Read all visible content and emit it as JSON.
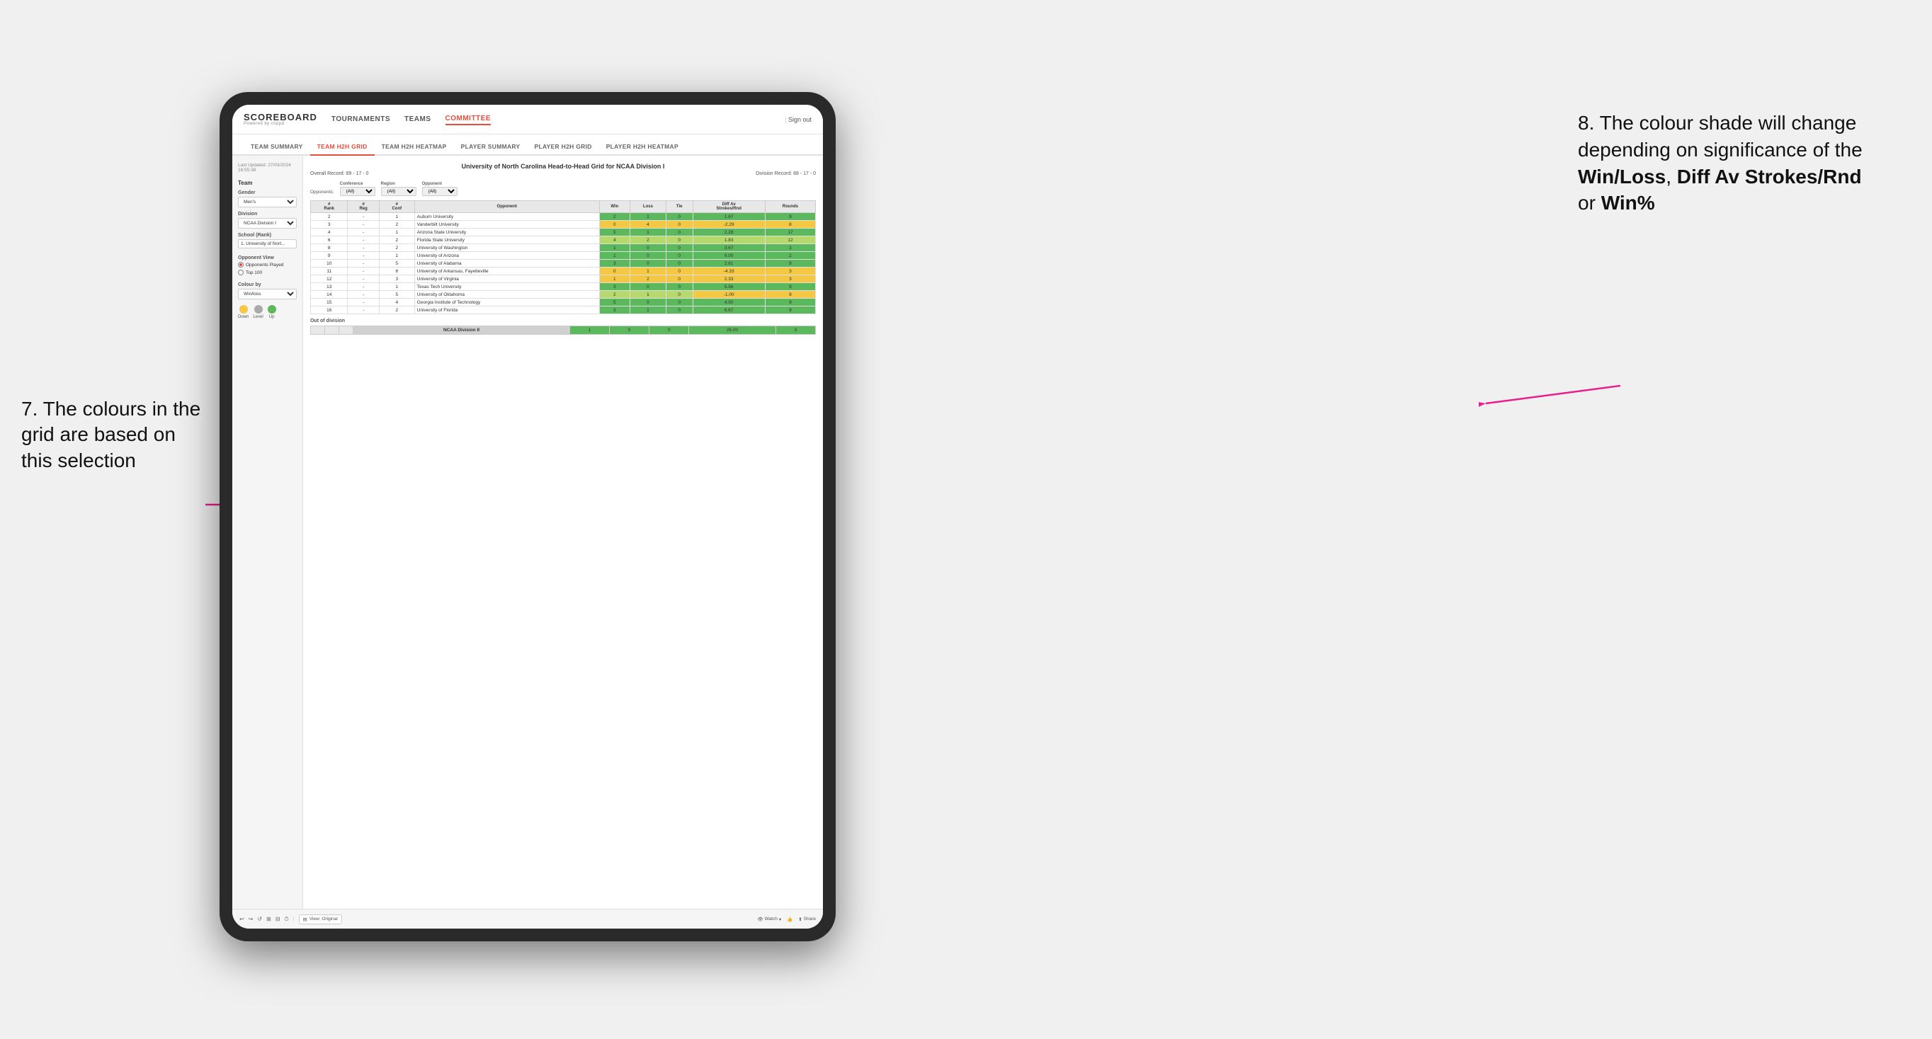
{
  "app": {
    "logo": "SCOREBOARD",
    "logo_sub": "Powered by clippd",
    "sign_out": "Sign out"
  },
  "nav": {
    "items": [
      {
        "label": "TOURNAMENTS",
        "active": false
      },
      {
        "label": "TEAMS",
        "active": false
      },
      {
        "label": "COMMITTEE",
        "active": true
      }
    ]
  },
  "sub_nav": {
    "items": [
      {
        "label": "TEAM SUMMARY",
        "active": false
      },
      {
        "label": "TEAM H2H GRID",
        "active": true
      },
      {
        "label": "TEAM H2H HEATMAP",
        "active": false
      },
      {
        "label": "PLAYER SUMMARY",
        "active": false
      },
      {
        "label": "PLAYER H2H GRID",
        "active": false
      },
      {
        "label": "PLAYER H2H HEATMAP",
        "active": false
      }
    ]
  },
  "sidebar": {
    "timestamp_label": "Last Updated: 27/03/2024",
    "timestamp_time": "16:55:38",
    "team_label": "Team",
    "gender_label": "Gender",
    "gender_value": "Men's",
    "division_label": "Division",
    "division_value": "NCAA Division I",
    "school_label": "School (Rank)",
    "school_value": "1. University of Nort...",
    "opponent_view_label": "Opponent View",
    "radio_options": [
      {
        "label": "Opponents Played",
        "selected": true
      },
      {
        "label": "Top 100",
        "selected": false
      }
    ],
    "colour_by_label": "Colour by",
    "colour_by_value": "Win/loss",
    "legend": [
      {
        "color": "#f4c842",
        "label": "Down"
      },
      {
        "color": "#aaaaaa",
        "label": "Level"
      },
      {
        "color": "#5cb85c",
        "label": "Up"
      }
    ]
  },
  "grid": {
    "title": "University of North Carolina Head-to-Head Grid for NCAA Division I",
    "overall_record": "Overall Record: 89 - 17 - 0",
    "division_record": "Division Record: 88 - 17 - 0",
    "filters": {
      "opponents_label": "Opponents:",
      "conference_label": "Conference",
      "conference_value": "(All)",
      "region_label": "Region",
      "region_value": "(All)",
      "opponent_label": "Opponent",
      "opponent_value": "(All)"
    },
    "columns": [
      "#\nRank",
      "# Reg",
      "# Conf",
      "Opponent",
      "Win",
      "Loss",
      "Tie",
      "Diff Av\nStrokes/Rnd",
      "Rounds"
    ],
    "rows": [
      {
        "rank": "2",
        "reg": "-",
        "conf": "1",
        "opponent": "Auburn University",
        "win": "2",
        "loss": "1",
        "tie": "0",
        "diff": "1.67",
        "rounds": "9",
        "win_color": "green",
        "diff_color": "green"
      },
      {
        "rank": "3",
        "reg": "-",
        "conf": "2",
        "opponent": "Vanderbilt University",
        "win": "0",
        "loss": "4",
        "tie": "0",
        "diff": "-2.29",
        "rounds": "8",
        "win_color": "yellow",
        "diff_color": "yellow"
      },
      {
        "rank": "4",
        "reg": "-",
        "conf": "1",
        "opponent": "Arizona State University",
        "win": "5",
        "loss": "1",
        "tie": "0",
        "diff": "2.28",
        "rounds": "17",
        "win_color": "green",
        "diff_color": "green"
      },
      {
        "rank": "6",
        "reg": "-",
        "conf": "2",
        "opponent": "Florida State University",
        "win": "4",
        "loss": "2",
        "tie": "0",
        "diff": "1.83",
        "rounds": "12",
        "win_color": "green-light",
        "diff_color": "green-light"
      },
      {
        "rank": "8",
        "reg": "-",
        "conf": "2",
        "opponent": "University of Washington",
        "win": "1",
        "loss": "0",
        "tie": "0",
        "diff": "3.67",
        "rounds": "3",
        "win_color": "green",
        "diff_color": "green"
      },
      {
        "rank": "9",
        "reg": "-",
        "conf": "1",
        "opponent": "University of Arizona",
        "win": "1",
        "loss": "0",
        "tie": "0",
        "diff": "9.00",
        "rounds": "2",
        "win_color": "green",
        "diff_color": "green"
      },
      {
        "rank": "10",
        "reg": "-",
        "conf": "5",
        "opponent": "University of Alabama",
        "win": "3",
        "loss": "0",
        "tie": "0",
        "diff": "2.61",
        "rounds": "8",
        "win_color": "green",
        "diff_color": "green"
      },
      {
        "rank": "11",
        "reg": "-",
        "conf": "6",
        "opponent": "University of Arkansas, Fayetteville",
        "win": "0",
        "loss": "1",
        "tie": "0",
        "diff": "-4.33",
        "rounds": "3",
        "win_color": "yellow",
        "diff_color": "yellow"
      },
      {
        "rank": "12",
        "reg": "-",
        "conf": "3",
        "opponent": "University of Virginia",
        "win": "1",
        "loss": "2",
        "tie": "0",
        "diff": "2.33",
        "rounds": "3",
        "win_color": "yellow",
        "diff_color": "yellow"
      },
      {
        "rank": "13",
        "reg": "-",
        "conf": "1",
        "opponent": "Texas Tech University",
        "win": "3",
        "loss": "0",
        "tie": "0",
        "diff": "5.56",
        "rounds": "9",
        "win_color": "green",
        "diff_color": "green"
      },
      {
        "rank": "14",
        "reg": "-",
        "conf": "5",
        "opponent": "University of Oklahoma",
        "win": "2",
        "loss": "1",
        "tie": "0",
        "diff": "-1.00",
        "rounds": "9",
        "win_color": "green-light",
        "diff_color": "yellow"
      },
      {
        "rank": "15",
        "reg": "-",
        "conf": "4",
        "opponent": "Georgia Institute of Technology",
        "win": "5",
        "loss": "0",
        "tie": "0",
        "diff": "4.50",
        "rounds": "9",
        "win_color": "green",
        "diff_color": "green"
      },
      {
        "rank": "16",
        "reg": "-",
        "conf": "2",
        "opponent": "University of Florida",
        "win": "3",
        "loss": "1",
        "tie": "0",
        "diff": "6.67",
        "rounds": "9",
        "win_color": "green",
        "diff_color": "green"
      }
    ],
    "out_division_label": "Out of division",
    "out_division_row": {
      "label": "NCAA Division II",
      "win": "1",
      "loss": "0",
      "tie": "0",
      "diff": "26.00",
      "rounds": "3",
      "diff_color": "green"
    }
  },
  "toolbar": {
    "view_label": "View: Original",
    "watch_label": "Watch",
    "share_label": "Share"
  },
  "annotations": {
    "left": "7. The colours in the grid are based on this selection",
    "right_prefix": "8. The colour shade will change depending on significance of the ",
    "right_bold1": "Win/Loss",
    "right_sep1": ", ",
    "right_bold2": "Diff Av Strokes/Rnd",
    "right_sep2": " or ",
    "right_bold3": "Win%"
  }
}
